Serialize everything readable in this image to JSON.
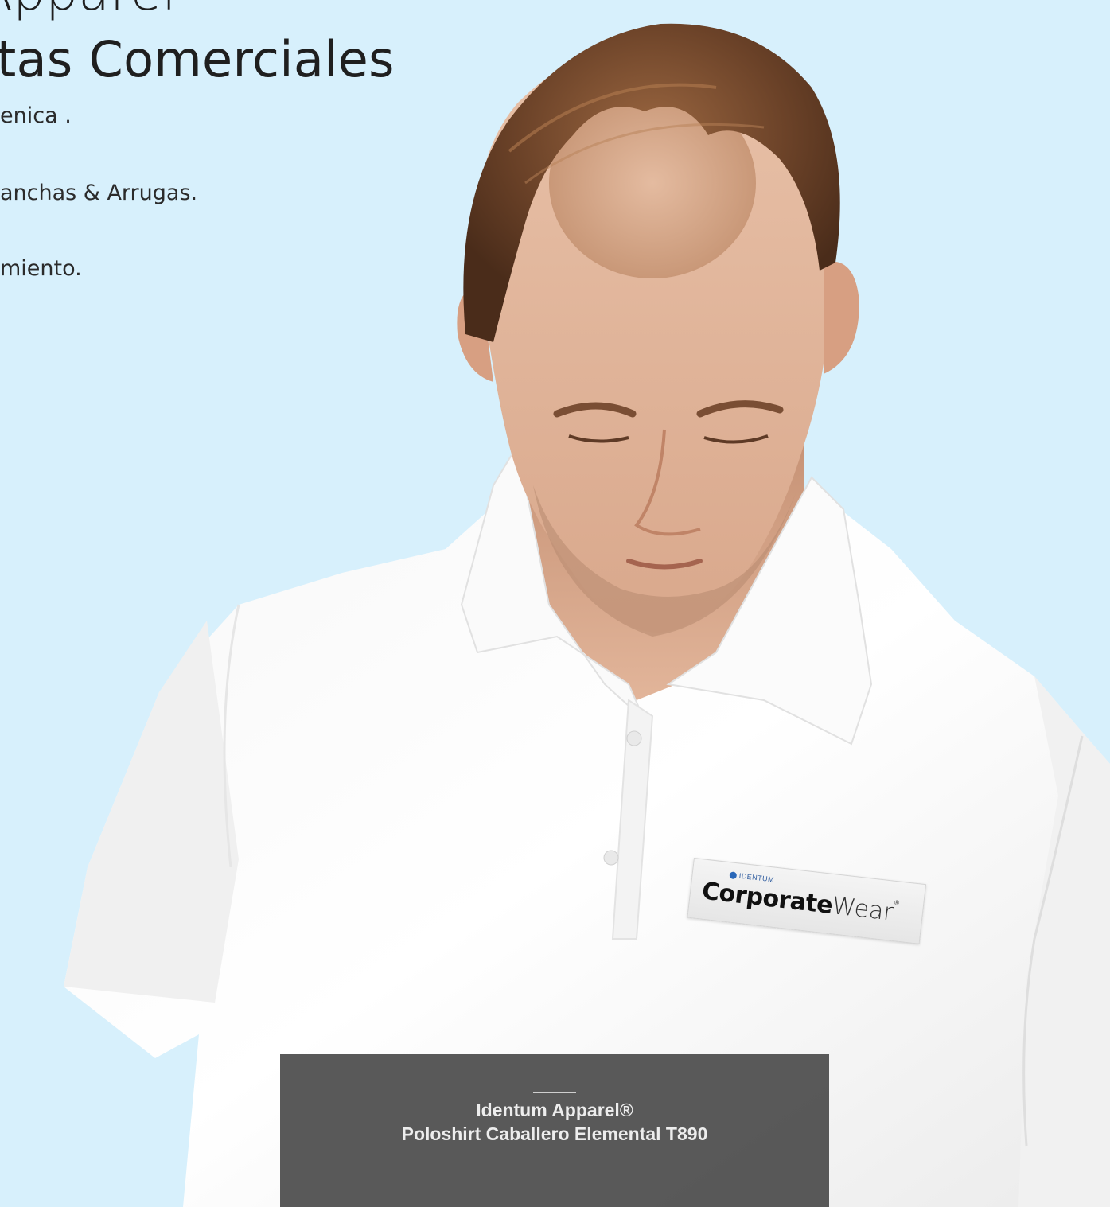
{
  "hero": {
    "title_line1": "Apparel",
    "title_line2": "tas Comerciales",
    "bullets": [
      "enica .",
      "anchas & Arrugas.",
      "miento."
    ]
  },
  "logo": {
    "brand_small": "IDENTUM",
    "main_bold": "Corporate",
    "main_light": "Wear",
    "registered": "®"
  },
  "caption": {
    "brand": "Identum Apparel®",
    "product": "Poloshirt Caballero Elemental T890"
  },
  "colors": {
    "background": "#d7f0fc",
    "caption_bg": "#4b4b4b",
    "caption_text": "#ededed"
  }
}
